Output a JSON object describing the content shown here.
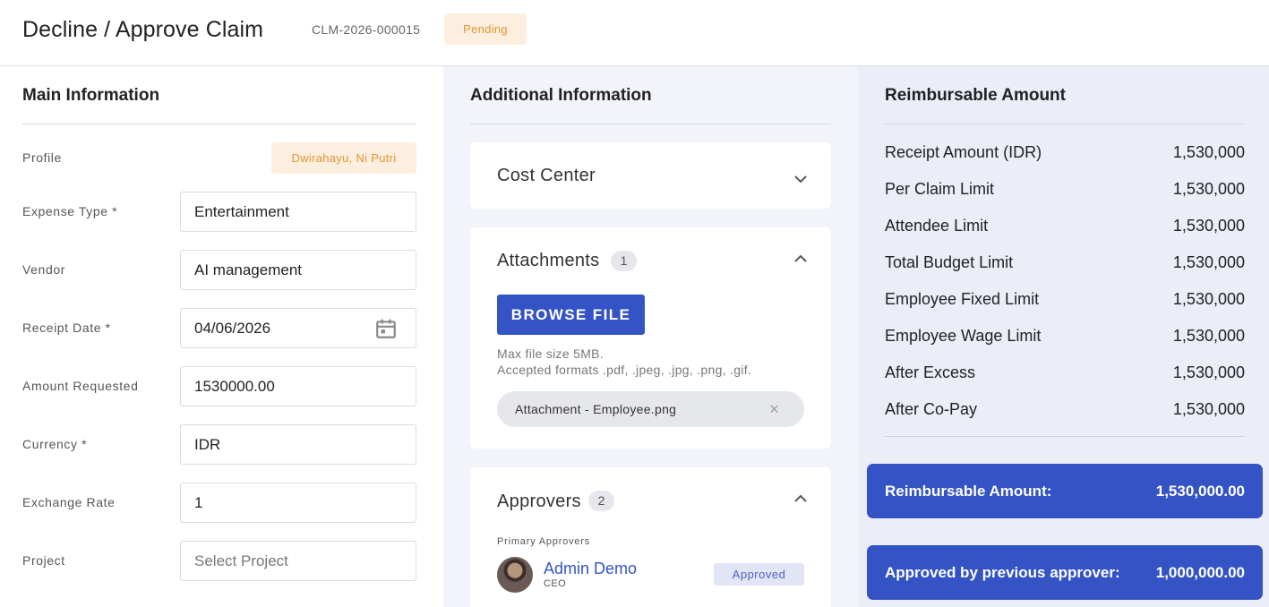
{
  "header": {
    "title": "Decline / Approve Claim",
    "claim_id": "CLM-2026-000015",
    "status": "Pending"
  },
  "main": {
    "title": "Main Information",
    "profile_label": "Profile",
    "profile_value": "Dwirahayu, Ni Putri",
    "fields": [
      {
        "label": "Expense Type *",
        "value": "Entertainment"
      },
      {
        "label": "Vendor",
        "value": "AI management"
      },
      {
        "label": "Receipt Date *",
        "value": "04/06/2026"
      },
      {
        "label": "Amount Requested",
        "value": "1530000.00"
      },
      {
        "label": "Currency *",
        "value": "IDR"
      },
      {
        "label": "Exchange Rate",
        "value": "1"
      },
      {
        "label": "Project",
        "placeholder": "Select Project"
      }
    ]
  },
  "additional": {
    "title": "Additional Information",
    "cost_center": {
      "title": "Cost Center"
    },
    "attachments": {
      "title": "Attachments",
      "count": "1",
      "browse_label": "BROWSE FILE",
      "hint_size": "Max file size 5MB.",
      "hint_formats": "Accepted formats .pdf, .jpeg, .jpg, .png, .gif.",
      "file_name": "Attachment - Employee.png",
      "remove_icon": "×"
    },
    "approvers": {
      "title": "Approvers",
      "count": "2",
      "section_label": "Primary Approvers",
      "items": [
        {
          "name": "Admin Demo",
          "role": "CEO",
          "status": "Approved"
        }
      ]
    }
  },
  "reimbursable": {
    "title": "Reimbursable Amount",
    "rows": [
      {
        "label": "Receipt Amount (IDR)",
        "value": "1,530,000"
      },
      {
        "label": "Per Claim Limit",
        "value": "1,530,000"
      },
      {
        "label": "Attendee Limit",
        "value": "1,530,000"
      },
      {
        "label": "Total Budget Limit",
        "value": "1,530,000"
      },
      {
        "label": "Employee Fixed Limit",
        "value": "1,530,000"
      },
      {
        "label": "Employee Wage Limit",
        "value": "1,530,000"
      },
      {
        "label": "After Excess",
        "value": "1,530,000"
      },
      {
        "label": "After Co-Pay",
        "value": "1,530,000"
      }
    ],
    "total_label": "Reimbursable Amount:",
    "total_value": "1,530,000.00",
    "previous_label": "Approved by previous approver:",
    "previous_value": "1,000,000.00"
  },
  "colors": {
    "accent": "#3453c4",
    "pending_bg": "#fcefdf",
    "pending_text": "#e39434",
    "approved_bg": "#e2e5f5"
  },
  "icons": {
    "date": "calendar-icon",
    "collapse": "chevron-up-icon",
    "expand": "chevron-down-icon",
    "remove": "close-icon"
  }
}
